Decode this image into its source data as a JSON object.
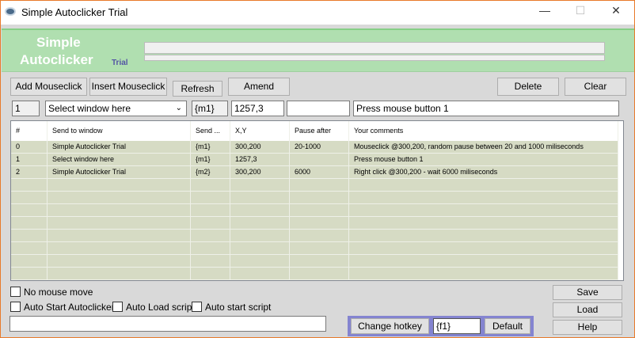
{
  "window": {
    "title": "Simple Autoclicker Trial",
    "minimize": "—",
    "maximize": "☐",
    "close": "✕"
  },
  "banner": {
    "logo_line1": "Simple",
    "logo_line2": "Autoclicker",
    "logo_trial": "Trial"
  },
  "toolbar": {
    "add": "Add Mouseclick",
    "insert": "Insert Mouseclick",
    "refresh": "Refresh",
    "amend": "Amend",
    "delete": "Delete",
    "clear": "Clear"
  },
  "editor": {
    "index": "1",
    "window_select": "Select window here",
    "send": "{m1}",
    "xy": "1257,3",
    "pause": "",
    "comment": "Press mouse button 1"
  },
  "table": {
    "headers": [
      "#",
      "Send to window",
      "Send ...",
      "X,Y",
      "Pause after",
      "Your comments"
    ],
    "rows": [
      [
        "0",
        "Simple Autoclicker Trial",
        "{m1}",
        "300,200",
        "20-1000",
        "Mouseclick @300,200, random pause between 20 and 1000 miliseconds"
      ],
      [
        "1",
        "Select window here",
        "{m1}",
        "1257,3",
        "",
        "Press mouse button 1"
      ],
      [
        "2",
        "Simple Autoclicker Trial",
        "{m2}",
        "300,200",
        "6000",
        "Right click @300,200 - wait 6000 miliseconds"
      ]
    ]
  },
  "options": {
    "no_mouse_move": "No mouse move",
    "auto_start": "Auto Start Autoclicker",
    "auto_load": "Auto Load script",
    "auto_start_script": "Auto start script"
  },
  "status_text": "",
  "hotkey": {
    "change": "Change hotkey",
    "value": "{f1}",
    "default": "Default"
  },
  "side": {
    "save": "Save",
    "load": "Load",
    "help": "Help"
  }
}
